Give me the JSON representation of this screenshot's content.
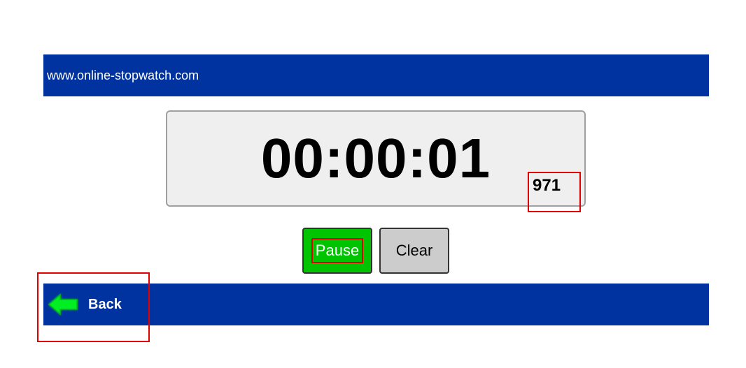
{
  "header": {
    "site_url": "www.online-stopwatch.com"
  },
  "timer": {
    "display": "00:00:01",
    "milliseconds": "971"
  },
  "controls": {
    "pause_label": "Pause",
    "clear_label": "Clear"
  },
  "footer": {
    "back_label": "Back"
  },
  "colors": {
    "bar_blue": "#0033a0",
    "pause_green": "#00c400",
    "clear_gray": "#cccccc",
    "arrow_green": "#00ee22",
    "highlight_red": "#e00000"
  },
  "icons": {
    "back": "arrow-left-icon"
  }
}
